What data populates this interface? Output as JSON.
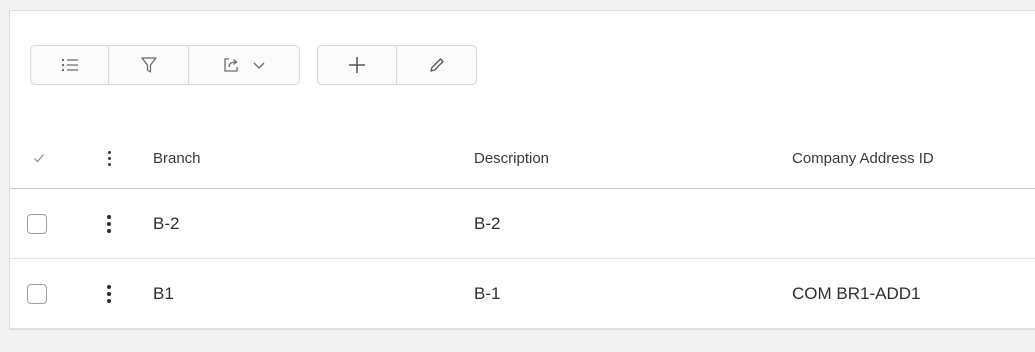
{
  "toolbar": {
    "groups": [
      {
        "buttons": [
          {
            "icon": "list-settings-icon"
          },
          {
            "icon": "filter-icon"
          },
          {
            "icon": "export-icon",
            "has_dropdown": true
          }
        ]
      },
      {
        "buttons": [
          {
            "icon": "plus-icon"
          },
          {
            "icon": "pencil-icon"
          }
        ]
      }
    ]
  },
  "grid": {
    "columns": [
      "Branch",
      "Description",
      "Company Address ID"
    ],
    "rows": [
      {
        "branch": "B-2",
        "description": "B-2",
        "company_address_id": ""
      },
      {
        "branch": "B1",
        "description": "B-1",
        "company_address_id": "COM BR1-ADD1"
      }
    ]
  },
  "colors": {
    "page_background": "#f2f2f2",
    "panel_background": "#ffffff",
    "border": "#d8d8d8",
    "text": "#333333"
  }
}
